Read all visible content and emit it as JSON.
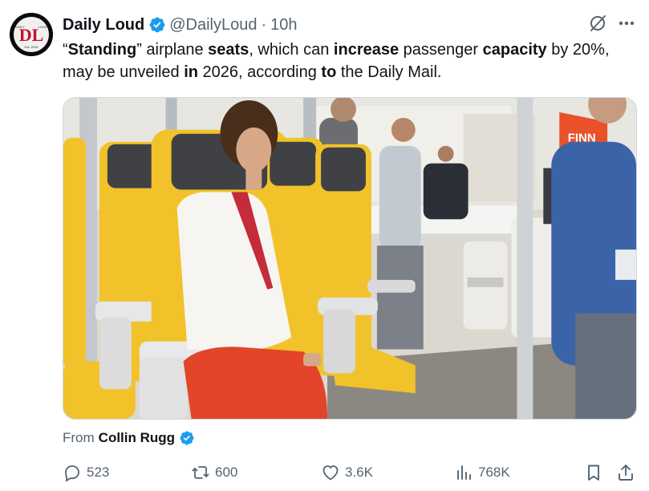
{
  "author": {
    "name": "Daily Loud",
    "handle": "@DailyLoud",
    "separator": "·",
    "time": "10h",
    "avatar_initials": "DL",
    "avatar_top_left": "DAILY",
    "avatar_top_right": "LOUD",
    "avatar_bottom": "Est. 2016"
  },
  "tweet": {
    "text_segments": [
      {
        "text": "“",
        "bold": false
      },
      {
        "text": "Standing",
        "bold": true
      },
      {
        "text": "” airplane ",
        "bold": false
      },
      {
        "text": "seats",
        "bold": true
      },
      {
        "text": ", which can ",
        "bold": false
      },
      {
        "text": "increase",
        "bold": true
      },
      {
        "text": " passenger ",
        "bold": false
      },
      {
        "text": "capacity",
        "bold": true
      },
      {
        "text": " by 20%, may be unveiled ",
        "bold": false
      },
      {
        "text": "in",
        "bold": true
      },
      {
        "text": " 2026, according ",
        "bold": false
      },
      {
        "text": "to",
        "bold": true
      },
      {
        "text": " the Daily Mail.",
        "bold": false
      }
    ]
  },
  "media": {
    "sign_text": "FINN"
  },
  "attribution": {
    "from_label": "From",
    "author": "Collin Rugg"
  },
  "stats": {
    "replies": "523",
    "reposts": "600",
    "likes": "3.6K",
    "views": "768K"
  },
  "colors": {
    "verified_blue": "#1d9bf0",
    "text_primary": "#0f1419",
    "text_secondary": "#536471",
    "seat_yellow": "#f2c22a",
    "avatar_red": "#c8102e"
  },
  "icons": {
    "verified": "verified-badge-icon",
    "grok": "grok-icon",
    "more": "more-icon",
    "reply": "reply-icon",
    "repost": "repost-icon",
    "like": "heart-icon",
    "views": "views-bar-icon",
    "bookmark": "bookmark-icon",
    "share": "share-icon"
  }
}
